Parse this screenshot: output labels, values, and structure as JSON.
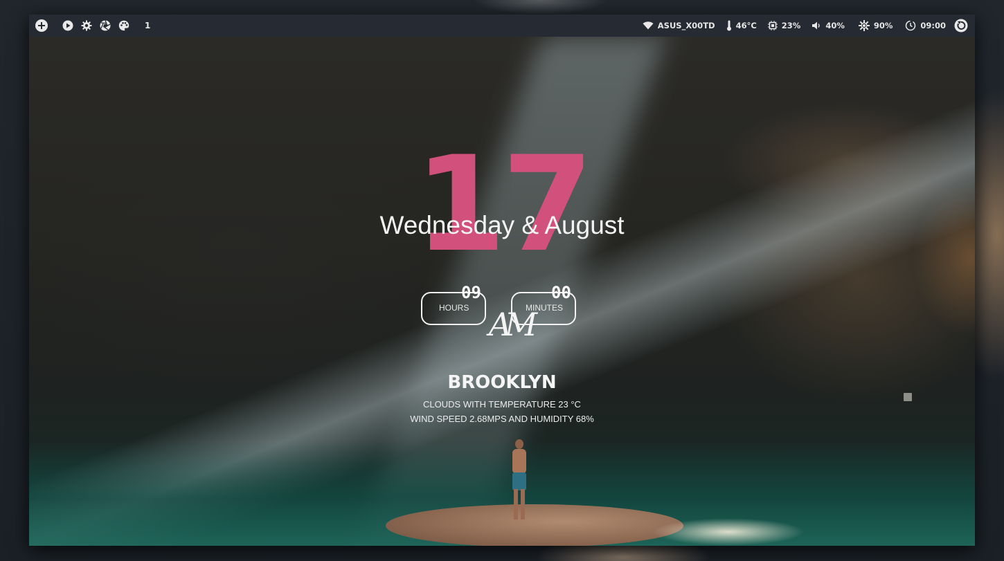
{
  "topbar": {
    "left_icons": [
      "add-circle-icon",
      "play-icon",
      "gear-icon",
      "aperture-icon",
      "palette-icon"
    ],
    "workspace": "1",
    "wifi": {
      "icon": "wifi-icon",
      "label": "ASUS_X00TD"
    },
    "temperature": {
      "icon": "thermometer-icon",
      "label": "46°C"
    },
    "cpu": {
      "icon": "cpu-icon",
      "label": "23%"
    },
    "volume": {
      "icon": "volume-icon",
      "label": "40%"
    },
    "brightness": {
      "icon": "brightness-icon",
      "label": "90%"
    },
    "clock": {
      "icon": "clock-icon",
      "label": "09:00"
    },
    "power_icon": "power-icon"
  },
  "date": {
    "day": "17",
    "weekday_month": "Wednesday & August"
  },
  "time": {
    "hours": "09",
    "hours_label": "HOURS",
    "minutes": "00",
    "minutes_label": "MINUTES",
    "meridiem": "AM"
  },
  "weather": {
    "city": "BROOKLYN",
    "line1": "CLOUDS WITH TEMPERATURE 23 °C",
    "line2": "WIND SPEED 2.68MPS AND HUMIDITY 68%"
  },
  "colors": {
    "accent": "#d2517c",
    "bar_bg": "#262b33",
    "text": "#e6e6e6"
  }
}
